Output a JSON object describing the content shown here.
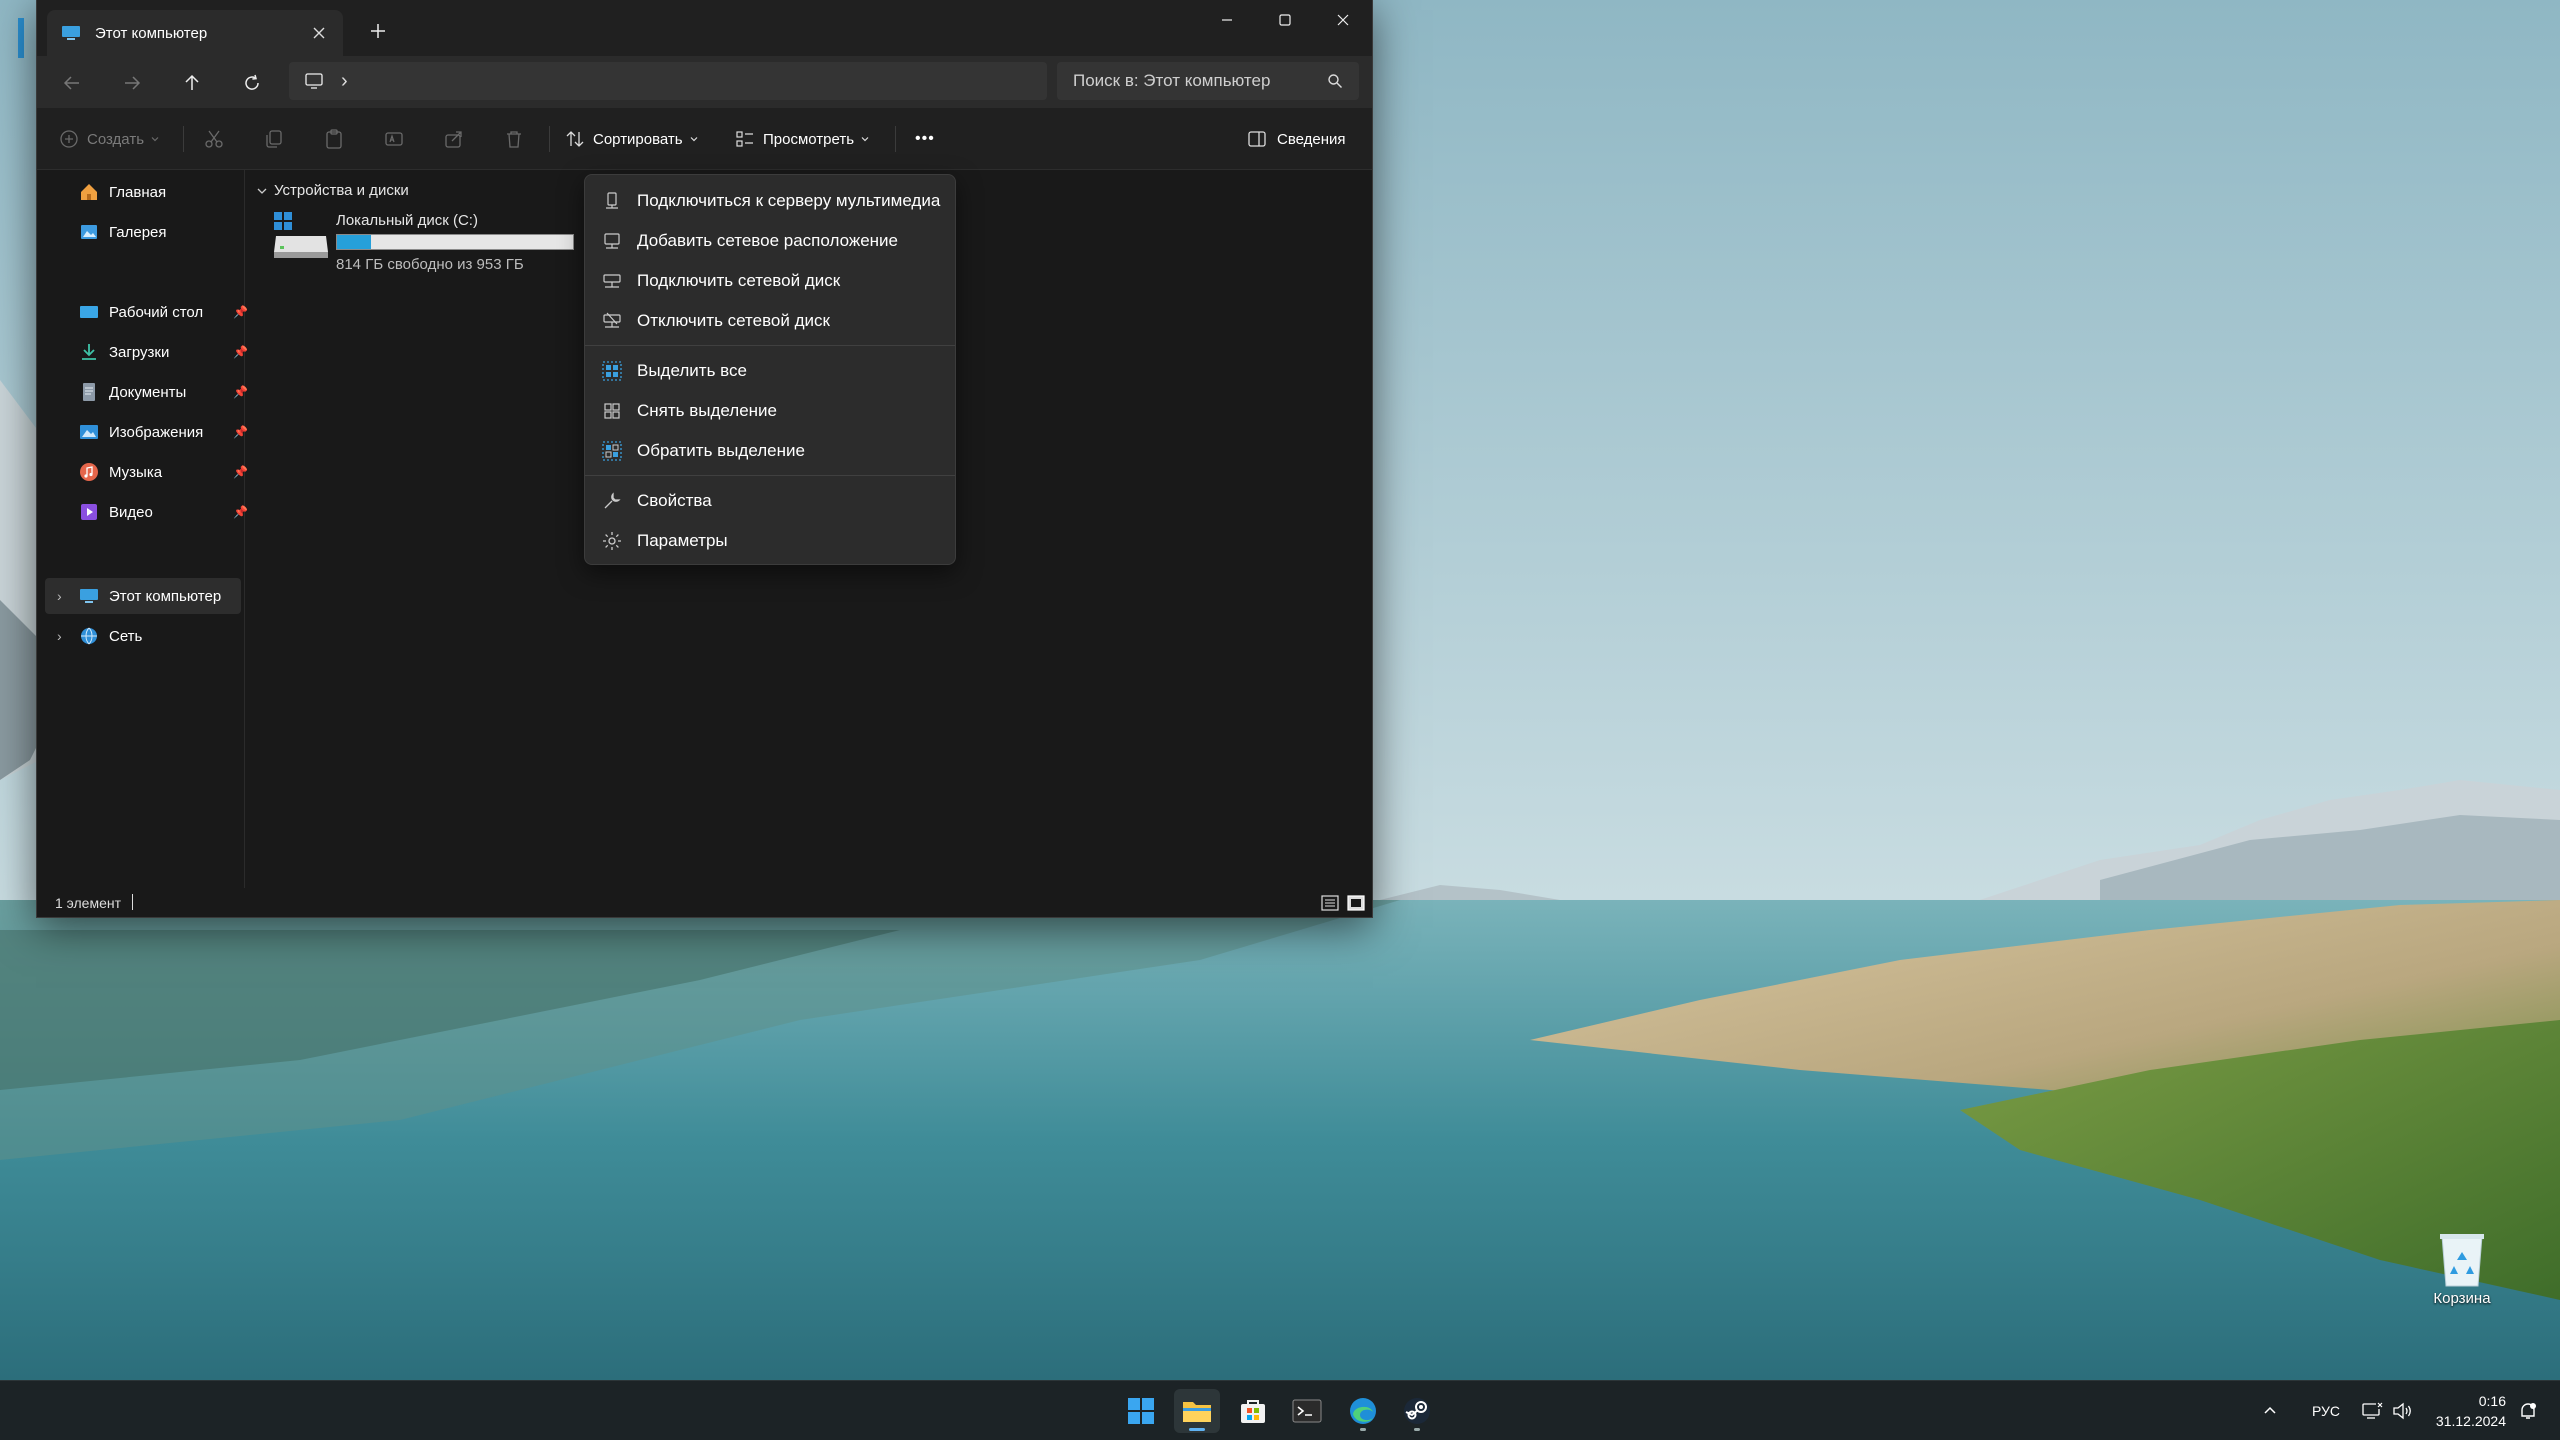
{
  "window": {
    "tab_title": "Этот компьютер",
    "new_tab_glyph": "+",
    "controls": [
      "minimize-icon",
      "maximize-icon",
      "close-icon"
    ]
  },
  "navbar": {
    "breadcrumb_separator": "›",
    "search_placeholder": "Поиск в: Этот компьютер"
  },
  "commandbar": {
    "create_label": "Создать",
    "sort_label": "Сортировать",
    "view_label": "Просмотреть",
    "more_label": "•••",
    "details_label": "Сведения"
  },
  "sidebar": {
    "items": [
      {
        "label": "Главная",
        "icon": "home-icon"
      },
      {
        "label": "Галерея",
        "icon": "gallery-icon"
      },
      {
        "label": "Рабочий стол",
        "icon": "desktop-icon",
        "pinned": true
      },
      {
        "label": "Загрузки",
        "icon": "download-icon",
        "pinned": true
      },
      {
        "label": "Документы",
        "icon": "documents-icon",
        "pinned": true
      },
      {
        "label": "Изображения",
        "icon": "pictures-icon",
        "pinned": true
      },
      {
        "label": "Музыка",
        "icon": "music-icon",
        "pinned": true
      },
      {
        "label": "Видео",
        "icon": "video-icon",
        "pinned": true
      },
      {
        "label": "Этот компьютер",
        "icon": "this-pc-icon",
        "selected": true
      },
      {
        "label": "Сеть",
        "icon": "network-icon"
      }
    ]
  },
  "content": {
    "group_header": "Устройства и диски",
    "drive": {
      "name": "Локальный диск (C:)",
      "free_text": "814 ГБ свободно из 953 ГБ",
      "used_fraction": 0.146
    }
  },
  "status": {
    "count_text": "1 элемент"
  },
  "context_menu": {
    "items": [
      {
        "label": "Подключиться к серверу мультимедиа",
        "icon": "media-server-icon"
      },
      {
        "label": "Добавить сетевое расположение",
        "icon": "network-location-icon"
      },
      {
        "label": "Подключить сетевой диск",
        "icon": "map-drive-icon"
      },
      {
        "label": "Отключить сетевой диск",
        "icon": "disconnect-drive-icon"
      },
      {
        "label": "Выделить все",
        "icon": "select-all-icon"
      },
      {
        "label": "Снять выделение",
        "icon": "select-none-icon"
      },
      {
        "label": "Обратить выделение",
        "icon": "invert-selection-icon"
      },
      {
        "label": "Свойства",
        "icon": "properties-icon"
      },
      {
        "label": "Параметры",
        "icon": "options-icon"
      }
    ]
  },
  "desktop": {
    "recycle_bin_label": "Корзина"
  },
  "taskbar": {
    "apps": [
      "start-icon",
      "file-explorer-icon",
      "store-icon",
      "terminal-icon",
      "edge-icon",
      "steam-icon"
    ],
    "tray": {
      "language": "РУС",
      "time": "0:16",
      "date": "31.12.2024"
    }
  },
  "colors": {
    "accent": "#26a0da",
    "window_bg": "#191919",
    "menu_bg": "#2c2c2c"
  }
}
